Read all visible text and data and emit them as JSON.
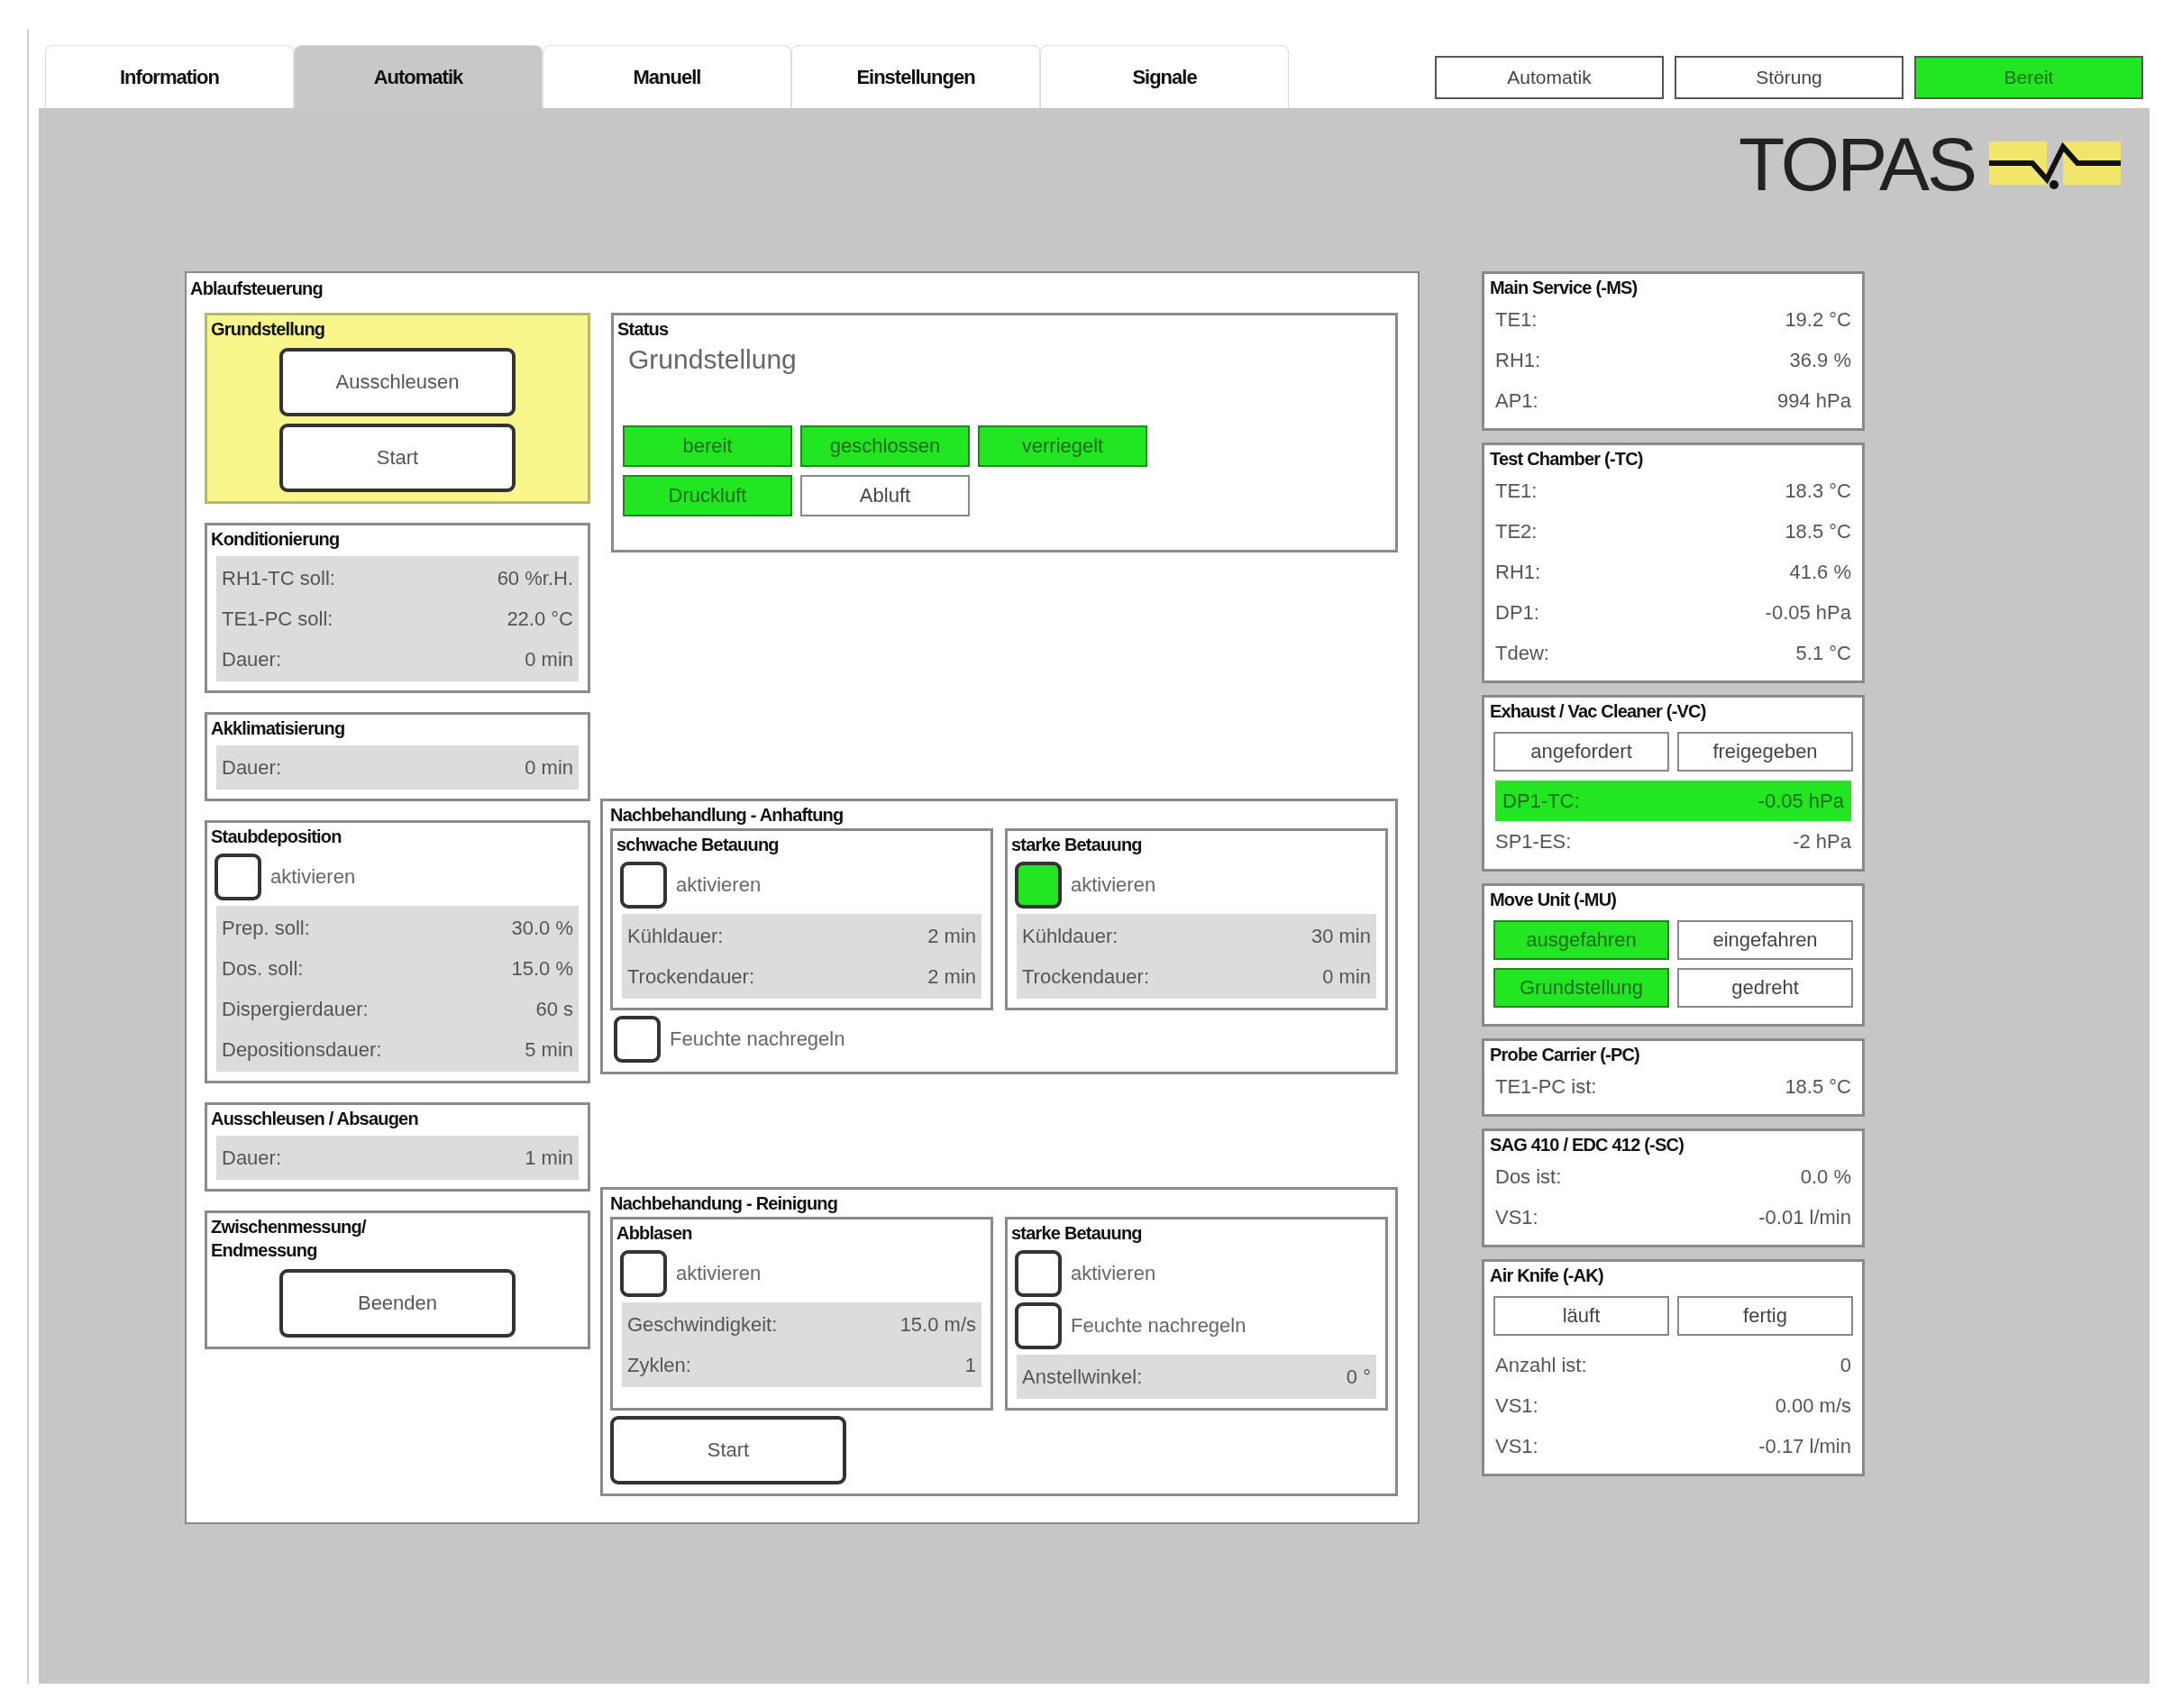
{
  "tabs": [
    {
      "label": "Information",
      "selected": false
    },
    {
      "label": "Automatik",
      "selected": true
    },
    {
      "label": "Manuell",
      "selected": false
    },
    {
      "label": "Einstellungen",
      "selected": false
    },
    {
      "label": "Signale",
      "selected": false
    }
  ],
  "indicators": [
    {
      "label": "Automatik",
      "on": false
    },
    {
      "label": "Störung",
      "on": false
    },
    {
      "label": "Bereit",
      "on": true
    }
  ],
  "logo": {
    "text": "TOPAS"
  },
  "sequence": {
    "title": "Ablaufsteuerung",
    "groups": [
      {
        "title": "Grundstellung",
        "active": true,
        "items": [
          {
            "kind": "button",
            "label": "Ausschleusen"
          },
          {
            "kind": "button",
            "label": "Start"
          }
        ]
      },
      {
        "title": "Konditionierung",
        "active": false,
        "items": [
          {
            "kind": "reading",
            "label": "RH1-TC soll:",
            "value": "60 %r.H."
          },
          {
            "kind": "reading",
            "label": "TE1-PC soll:",
            "value": "22.0 °C"
          },
          {
            "kind": "reading",
            "label": "Dauer:",
            "value": "0 min"
          }
        ]
      },
      {
        "title": "Akklimatisierung",
        "active": false,
        "items": [
          {
            "kind": "reading",
            "label": "Dauer:",
            "value": "0 min"
          }
        ]
      },
      {
        "title": "Staubdeposition",
        "active": false,
        "items": [
          {
            "kind": "checkbox",
            "label": "aktivieren",
            "checked": false
          },
          {
            "kind": "reading",
            "label": "Prep. soll:",
            "value": "30.0 %"
          },
          {
            "kind": "reading",
            "label": "Dos. soll:",
            "value": "15.0 %"
          },
          {
            "kind": "reading",
            "label": "Dispergierdauer:",
            "value": "60 s"
          },
          {
            "kind": "reading",
            "label": "Depositionsdauer:",
            "value": "5 min"
          }
        ]
      },
      {
        "title": "Ausschleusen / Absaugen",
        "active": false,
        "items": [
          {
            "kind": "reading",
            "label": "Dauer:",
            "value": "1 min"
          }
        ]
      },
      {
        "title": "Zwischenmessung/\nEndmessung",
        "active": false,
        "items": [
          {
            "kind": "button",
            "label": "Beenden"
          }
        ]
      }
    ],
    "status": {
      "title": "Status",
      "text": "Grundstellung",
      "indicators": [
        {
          "label": "bereit",
          "on": true
        },
        {
          "label": "geschlossen",
          "on": true
        },
        {
          "label": "verriegelt",
          "on": true
        },
        {
          "label": "Druckluft",
          "on": true
        },
        {
          "label": "Abluft",
          "on": false
        }
      ]
    },
    "treatments": [
      {
        "title": "Nachbehandlung - Anhaftung",
        "sections": [
          {
            "title": "schwache Betauung",
            "items": [
              {
                "kind": "checkbox",
                "label": "aktivieren",
                "checked": false
              },
              {
                "kind": "reading",
                "label": "Kühldauer:",
                "value": "2 min"
              },
              {
                "kind": "reading",
                "label": "Trockendauer:",
                "value": "2 min"
              }
            ]
          },
          {
            "title": "starke Betauung",
            "items": [
              {
                "kind": "checkbox",
                "label": "aktivieren",
                "checked": true
              },
              {
                "kind": "reading",
                "label": "Kühldauer:",
                "value": "30 min"
              },
              {
                "kind": "reading",
                "label": "Trockendauer:",
                "value": "0 min"
              }
            ]
          }
        ],
        "footer": [
          {
            "kind": "checkbox",
            "label": "Feuchte nachregeln",
            "checked": false
          }
        ]
      },
      {
        "title": "Nachbehandung - Reinigung",
        "sections": [
          {
            "title": "Abblasen",
            "items": [
              {
                "kind": "checkbox",
                "label": "aktivieren",
                "checked": false
              },
              {
                "kind": "reading",
                "label": "Geschwindigkeit:",
                "value": "15.0 m/s"
              },
              {
                "kind": "reading",
                "label": "Zyklen:",
                "value": "1"
              }
            ]
          },
          {
            "title": "starke Betauung",
            "items": [
              {
                "kind": "checkbox",
                "label": "aktivieren",
                "checked": false
              },
              {
                "kind": "checkbox",
                "label": "Feuchte nachregeln",
                "checked": false
              },
              {
                "kind": "reading",
                "label": "Anstellwinkel:",
                "value": "0 °"
              }
            ]
          }
        ],
        "footer": [
          {
            "kind": "button",
            "label": "Start"
          }
        ]
      }
    ]
  },
  "monitors": [
    {
      "title": "Main Service (-MS)",
      "items": [
        {
          "kind": "reading",
          "label": "TE1:",
          "value": "19.2 °C",
          "on": false
        },
        {
          "kind": "reading",
          "label": "RH1:",
          "value": "36.9 %",
          "on": false
        },
        {
          "kind": "reading",
          "label": "AP1:",
          "value": "994 hPa",
          "on": false
        }
      ]
    },
    {
      "title": "Test Chamber (-TC)",
      "items": [
        {
          "kind": "reading",
          "label": "TE1:",
          "value": "18.3 °C",
          "on": false
        },
        {
          "kind": "reading",
          "label": "TE2:",
          "value": "18.5 °C",
          "on": false
        },
        {
          "kind": "reading",
          "label": "RH1:",
          "value": "41.6 %",
          "on": false
        },
        {
          "kind": "reading",
          "label": "DP1:",
          "value": "-0.05 hPa",
          "on": false
        },
        {
          "kind": "reading",
          "label": "Tdew:",
          "value": "5.1 °C",
          "on": false
        }
      ]
    },
    {
      "title": "Exhaust / Vac Cleaner (-VC)",
      "items": [
        {
          "kind": "indicator",
          "label": "angefordert",
          "on": false
        },
        {
          "kind": "indicator",
          "label": "freigegeben",
          "on": false
        },
        {
          "kind": "reading",
          "label": "DP1-TC:",
          "value": "-0.05 hPa",
          "on": true
        },
        {
          "kind": "reading",
          "label": "SP1-ES:",
          "value": "-2 hPa",
          "on": false
        }
      ]
    },
    {
      "title": "Move Unit (-MU)",
      "items": [
        {
          "kind": "indicator",
          "label": "ausgefahren",
          "on": true
        },
        {
          "kind": "indicator",
          "label": "eingefahren",
          "on": false
        },
        {
          "kind": "indicator",
          "label": "Grundstellung",
          "on": true
        },
        {
          "kind": "indicator",
          "label": "gedreht",
          "on": false
        }
      ]
    },
    {
      "title": "Probe Carrier (-PC)",
      "items": [
        {
          "kind": "reading",
          "label": "TE1-PC ist:",
          "value": "18.5 °C",
          "on": false
        }
      ]
    },
    {
      "title": "SAG 410 / EDC 412 (-SC)",
      "items": [
        {
          "kind": "reading",
          "label": "Dos ist:",
          "value": "0.0 %",
          "on": false
        },
        {
          "kind": "reading",
          "label": "VS1:",
          "value": "-0.01 l/min",
          "on": false
        }
      ]
    },
    {
      "title": "Air Knife (-AK)",
      "items": [
        {
          "kind": "indicator",
          "label": "läuft",
          "on": false
        },
        {
          "kind": "indicator",
          "label": "fertig",
          "on": false
        },
        {
          "kind": "reading",
          "label": "Anzahl ist:",
          "value": "0",
          "on": false
        },
        {
          "kind": "reading",
          "label": "VS1:",
          "value": "0.00 m/s",
          "on": false
        },
        {
          "kind": "reading",
          "label": "VS1:",
          "value": "-0.17 l/min",
          "on": false
        }
      ]
    }
  ]
}
